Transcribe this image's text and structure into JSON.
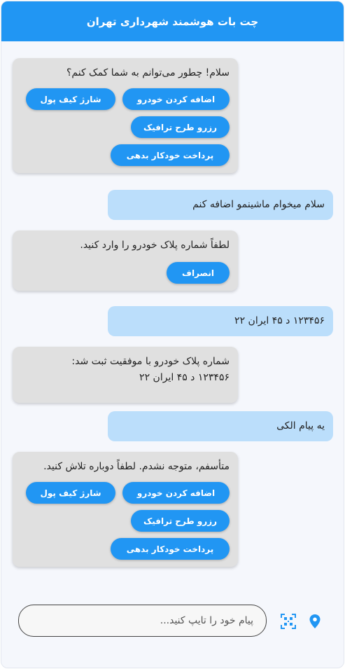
{
  "header": {
    "title": "چت بات هوشمند شهرداری تهران"
  },
  "messages": [
    {
      "from": "bot",
      "text": "سلام! چطور می‌توانم به شما کمک کنم؟",
      "buttons": [
        "اضافه کردن خودرو",
        "شارژ کیف پول",
        "رزرو طرح ترافیک",
        "پرداخت خودکار بدهی"
      ]
    },
    {
      "from": "user",
      "text": "سلام میخوام ماشینمو اضافه کنم"
    },
    {
      "from": "bot",
      "text": "لطفاً شماره پلاک خودرو را وارد کنید.",
      "buttons": [
        "انصراف"
      ]
    },
    {
      "from": "user",
      "text": "۱۲۳۴۵۶ د ۴۵ ایران ۲۲"
    },
    {
      "from": "bot",
      "text_line1": "شماره پلاک خودرو با موفقیت ثبت شد:",
      "text_line2": "۱۲۳۴۵۶ د ۴۵ ایران ۲۲"
    },
    {
      "from": "user",
      "text": "یه پیام الکی"
    },
    {
      "from": "bot",
      "text": "متأسفم، متوجه نشدم. لطفاً دوباره تلاش کنید.",
      "buttons": [
        "اضافه کردن خودرو",
        "شارژ کیف پول",
        "رزرو طرح ترافیک",
        "پرداخت خودکار بدهی"
      ]
    }
  ],
  "composer": {
    "placeholder": "پیام خود را تایپ کنید..."
  },
  "icons": {
    "location": "location-pin-icon",
    "qr": "qr-code-icon"
  },
  "colors": {
    "primary": "#2196f3",
    "bot_bubble": "#e0e0e0",
    "user_bubble": "#bbdefb",
    "background": "#f5f7fc"
  }
}
